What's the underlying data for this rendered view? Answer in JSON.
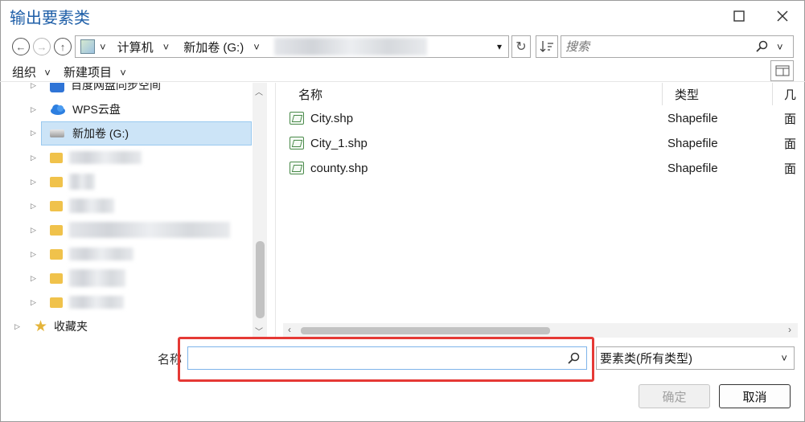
{
  "window": {
    "title": "输出要素类"
  },
  "address": {
    "crumbs": [
      "计算机",
      "新加卷 (G:)"
    ],
    "chevron": "˅",
    "dropdown": "▾",
    "refresh": "↻"
  },
  "search": {
    "placeholder": "搜索"
  },
  "toolbar": {
    "organize": "组织",
    "new_item": "新建项目"
  },
  "tree": {
    "items": [
      {
        "label": "百度网盘同步空间",
        "icon": "baidu-icon"
      },
      {
        "label": "WPS云盘",
        "icon": "cloud-icon"
      },
      {
        "label": "新加卷 (G:)",
        "icon": "drive-icon",
        "selected": true
      }
    ],
    "favorites": "收藏夹"
  },
  "columns": [
    "名称",
    "类型",
    "几"
  ],
  "files": [
    {
      "name": "City.shp",
      "type": "Shapefile",
      "geom": "面"
    },
    {
      "name": "City_1.shp",
      "type": "Shapefile",
      "geom": "面"
    },
    {
      "name": "county.shp",
      "type": "Shapefile",
      "geom": "面"
    }
  ],
  "bottom": {
    "name_label": "名称",
    "name_value": "",
    "type_selected": "要素类(所有类型)",
    "ok": "确定",
    "cancel": "取消"
  },
  "colors": {
    "title": "#1f5fa8",
    "selection": "#cce4f7",
    "highlight": "#e53935"
  }
}
